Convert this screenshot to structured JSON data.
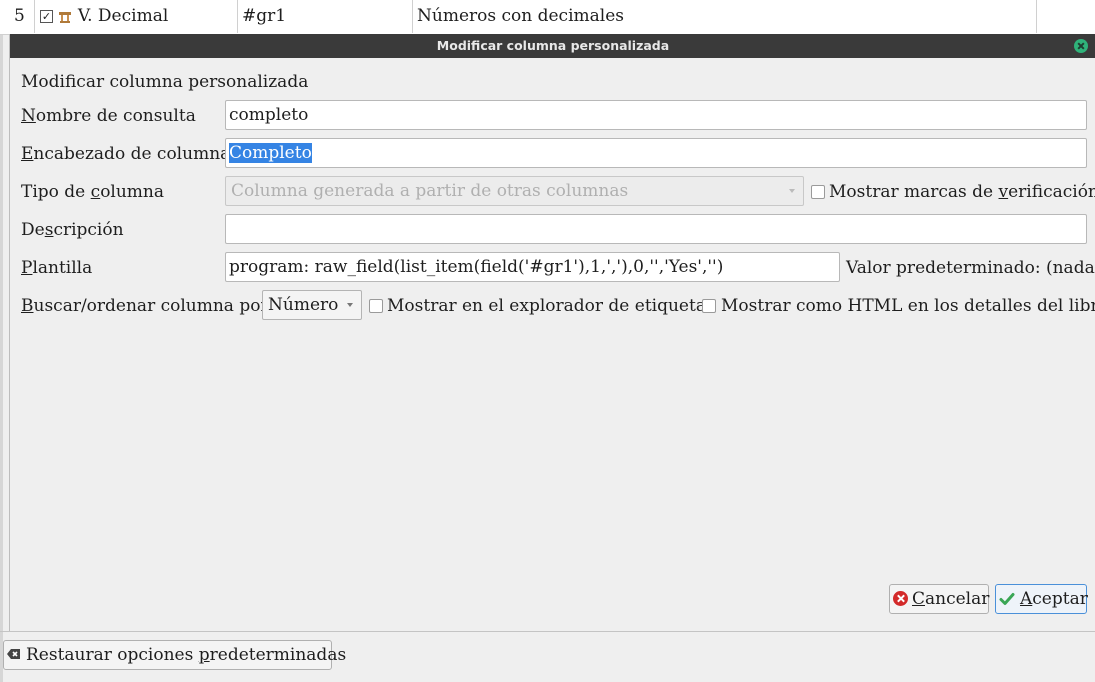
{
  "background_row": {
    "number": "5",
    "name": "V. Decimal",
    "lookup": "#gr1",
    "description": "Números con decimales"
  },
  "dialog": {
    "title": "Modificar columna personalizada",
    "heading": "Modificar columna personalizada",
    "lookup_name": {
      "mnemonic": "N",
      "rest": "ombre de consulta",
      "value": "completo"
    },
    "column_heading": {
      "mnemonic": "E",
      "rest": "ncabezado de columna",
      "value": "Completo"
    },
    "column_type": {
      "pre": "Tipo de ",
      "mnemonic": "c",
      "rest": "olumna",
      "value": "Columna generada a partir de otras columnas"
    },
    "show_checkmarks": {
      "pre": "Mostrar marcas de ",
      "mnemonic": "v",
      "rest": "erificación"
    },
    "description": {
      "pre": "De",
      "mnemonic": "s",
      "rest": "cripción",
      "value": ""
    },
    "template": {
      "mnemonic": "P",
      "rest": "lantilla",
      "value": "program: raw_field(list_item(field('#gr1'),1,','),0,'','Yes','')"
    },
    "default_value": "Valor predeterminado: (nada)",
    "sort_by": {
      "mnemonic": "B",
      "rest": "uscar/ordenar columna por",
      "value": "Número"
    },
    "show_in_tag_browser": "Mostrar en el explorador de etiquetas",
    "show_as_html": "Mostrar como HTML en los detalles del libro",
    "cancel": {
      "mnemonic": "C",
      "rest": "ancelar"
    },
    "accept": {
      "mnemonic": "A",
      "rest": "ceptar"
    }
  },
  "restore_defaults": {
    "pre": "Restaurar opciones ",
    "mnemonic": "p",
    "rest": "redeterminadas"
  },
  "colors": {
    "titlebar": "#3a3a3a",
    "close": "#2fb37a",
    "selection": "#3584e4",
    "cancel_icon": "#d32a2a",
    "accept_icon": "#3aa655"
  },
  "icons": [
    "close-icon",
    "cancel-icon",
    "checkmark-icon",
    "restore-icon",
    "tag-icon"
  ]
}
